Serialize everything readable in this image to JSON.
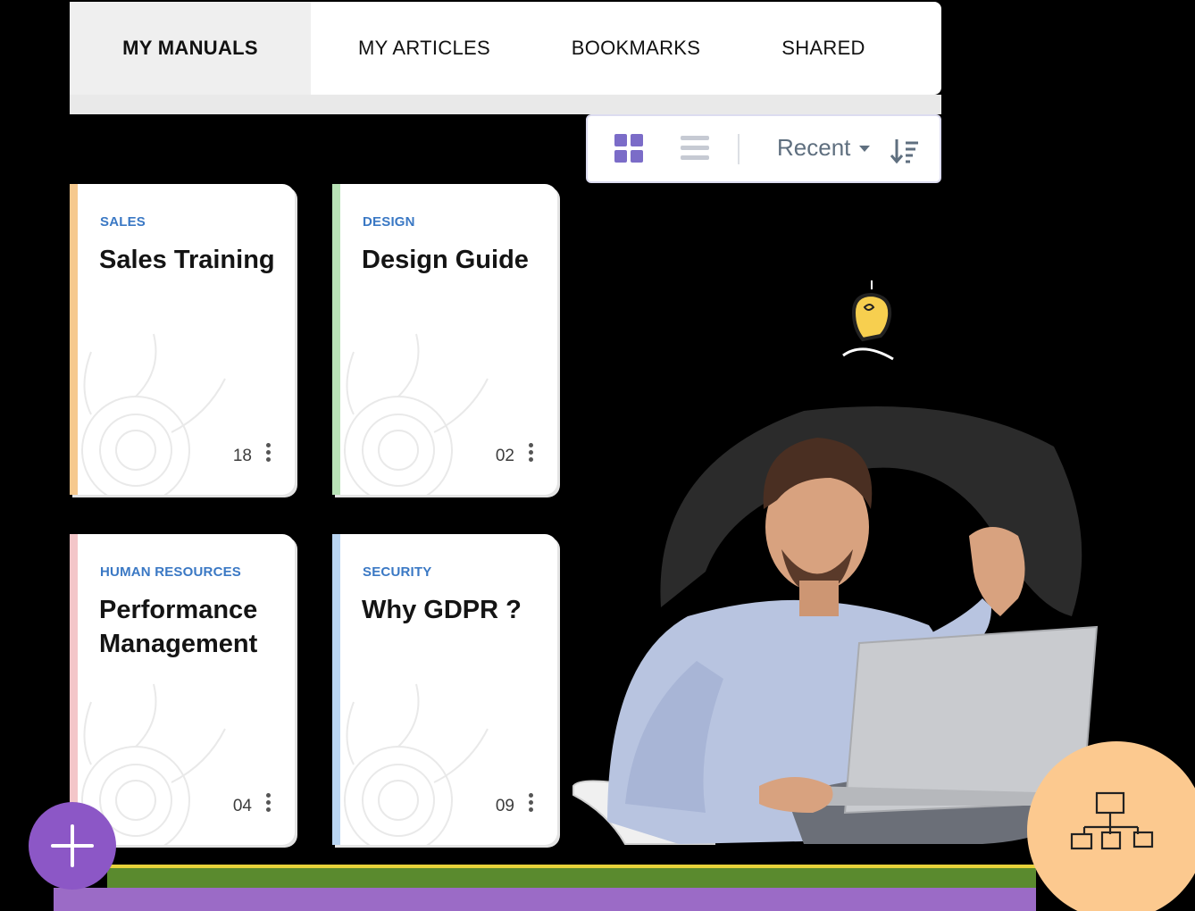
{
  "tabs": [
    {
      "label": "MY MANUALS",
      "active": true
    },
    {
      "label": "MY ARTICLES",
      "active": false
    },
    {
      "label": "BOOKMARKS",
      "active": false
    },
    {
      "label": "SHARED",
      "active": false
    }
  ],
  "toolbar": {
    "sort_label": "Recent",
    "grid_icon": "grid-view-icon",
    "list_icon": "list-view-icon",
    "sort_icon": "sort-descending-icon",
    "accent_color": "#7b6cc8"
  },
  "cards": [
    {
      "category": "SALES",
      "title": "Sales Training",
      "count": "18",
      "accent": "#f6c98e"
    },
    {
      "category": "DESIGN",
      "title": "Design Guide",
      "count": "02",
      "accent": "#b8e2b6"
    },
    {
      "category": "HUMAN RESOURCES",
      "title": "Performance Management",
      "count": "04",
      "accent": "#f3c6c9"
    },
    {
      "category": "SECURITY",
      "title": "Why GDPR ?",
      "count": "09",
      "accent": "#b9d5f2"
    }
  ],
  "fab": {
    "icon": "plus-icon",
    "color": "#8c57c6"
  },
  "decor": {
    "bulb_icon": "lightbulb-icon",
    "flowchart_icon": "flowchart-icon"
  }
}
